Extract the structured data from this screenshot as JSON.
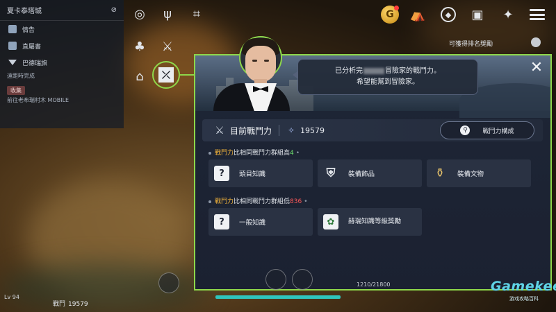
{
  "quest_panel": {
    "title": "夏卡泰塔城",
    "items": [
      {
        "label": "情告",
        "icon": "map-icon"
      },
      {
        "label": "直屬書",
        "icon": "scroll-icon"
      },
      {
        "label": "巴德瑞旗",
        "icon": "flag-icon"
      }
    ],
    "hint": "遠距時完成",
    "tag": "收集",
    "sub": "前往老布瑞村木 MOBILE"
  },
  "hud": {
    "coin_label": "G",
    "level_text": "Lv 94",
    "bottom_power_label": "戰鬥",
    "bottom_power_value": "19579",
    "exp_text": "1210/21800",
    "rank_label": "可獲得排名獎勵"
  },
  "modal": {
    "speech_line1_pre": "已分析完",
    "speech_line1_post": "冒險家的戰鬥力。",
    "speech_line2": "希望能幫到冒險家。",
    "close_glyph": "✕",
    "current_power_label": "目前戰鬥力",
    "current_power_value": "19579",
    "compose_button": "戰鬥力構成",
    "section_high": {
      "hl": "戰鬥力",
      "text": "比相同戰鬥力群組高",
      "num": "4"
    },
    "section_low": {
      "hl": "戰鬥力",
      "text": "比相同戰鬥力群組低",
      "num": "836"
    },
    "high_cards": [
      {
        "label": "頭目知識",
        "icon": "book-icon"
      },
      {
        "label": "裝備飾品",
        "icon": "gear-icon"
      },
      {
        "label": "裝備文物",
        "icon": "relic-icon"
      }
    ],
    "low_cards": [
      {
        "label": "一般知識",
        "icon": "book-icon"
      },
      {
        "label": "赫瑞知識等級獎勵",
        "icon": "leaf-icon"
      }
    ]
  },
  "watermark": {
    "brand": "Gamekee",
    "sub": "游戏攻略百科"
  },
  "colors": {
    "highlight_green": "#8ed84a",
    "accent_orange": "#f2b33a",
    "positive": "#6ee06e",
    "negative": "#ff5a5a"
  }
}
